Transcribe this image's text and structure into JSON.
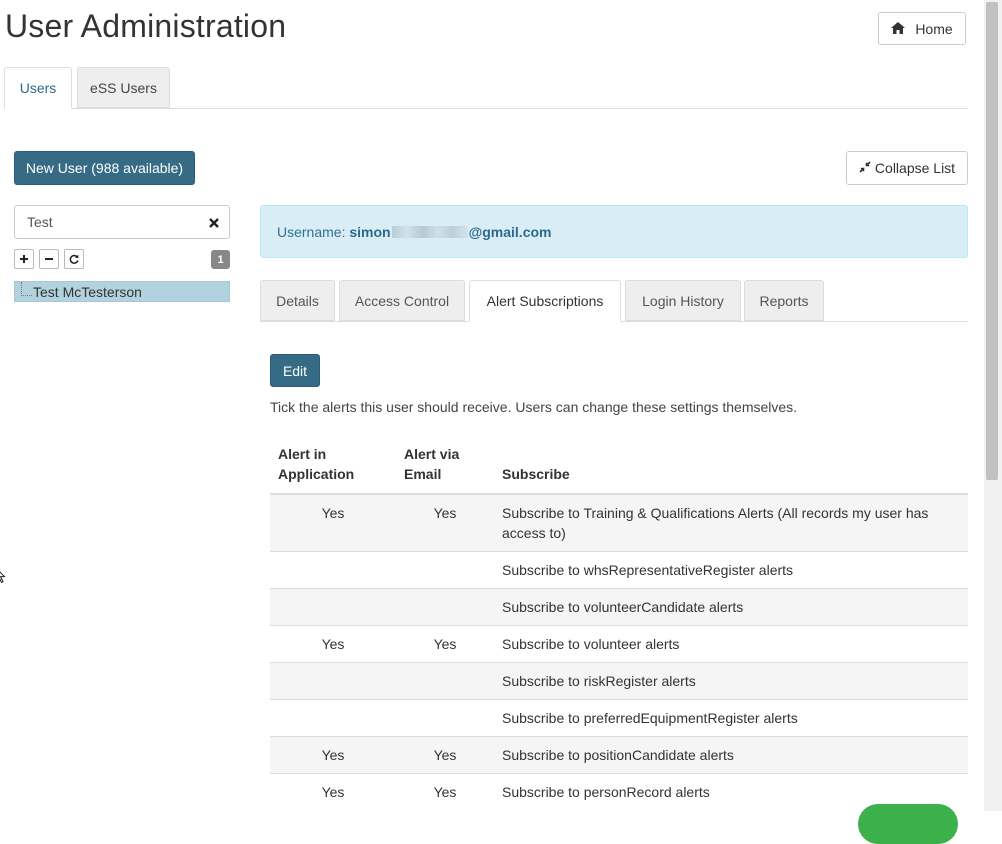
{
  "page": {
    "title": "User Administration",
    "home_label": "Home"
  },
  "top_tabs": {
    "users": "Users",
    "ess_users": "eSS Users"
  },
  "new_user_label": "New User (988 available)",
  "collapse_label": "Collapse List",
  "search": {
    "value": "Test"
  },
  "tree": {
    "count": "1",
    "selected_user": "Test McTesterson"
  },
  "user": {
    "username_label": "Username:",
    "username_start": "simon",
    "username_end": "@gmail.com"
  },
  "sub_tabs": {
    "details": "Details",
    "access_control": "Access Control",
    "alert_subscriptions": "Alert Subscriptions",
    "login_history": "Login History",
    "reports": "Reports"
  },
  "edit_label": "Edit",
  "help_text": "Tick the alerts this user should receive. Users can change these settings themselves.",
  "table": {
    "headers": {
      "in_app_line1": "Alert in",
      "in_app_line2": "Application",
      "email_line1": "Alert via",
      "email_line2": "Email",
      "subscribe": "Subscribe"
    },
    "rows": [
      {
        "in_app": "Yes",
        "email": "Yes",
        "subscribe": "Subscribe to Training & Qualifications Alerts (All records my user has access to)"
      },
      {
        "in_app": "",
        "email": "",
        "subscribe": "Subscribe to whsRepresentativeRegister alerts"
      },
      {
        "in_app": "",
        "email": "",
        "subscribe": "Subscribe to volunteerCandidate alerts"
      },
      {
        "in_app": "Yes",
        "email": "Yes",
        "subscribe": "Subscribe to volunteer alerts"
      },
      {
        "in_app": "",
        "email": "",
        "subscribe": "Subscribe to riskRegister alerts"
      },
      {
        "in_app": "",
        "email": "",
        "subscribe": "Subscribe to preferredEquipmentRegister alerts"
      },
      {
        "in_app": "Yes",
        "email": "Yes",
        "subscribe": "Subscribe to positionCandidate alerts"
      },
      {
        "in_app": "Yes",
        "email": "Yes",
        "subscribe": "Subscribe to personRecord alerts"
      }
    ]
  },
  "colors": {
    "primary": "#366b85",
    "info_bg": "#d9edf7",
    "tree_selected": "#b3d2df",
    "accent_green": "#3cb04a"
  },
  "icons": {
    "home": "home-icon",
    "collapse": "compress-icon",
    "clear": "close-icon",
    "expand": "plus-icon",
    "collapse_tree": "minus-icon",
    "refresh": "refresh-icon"
  }
}
